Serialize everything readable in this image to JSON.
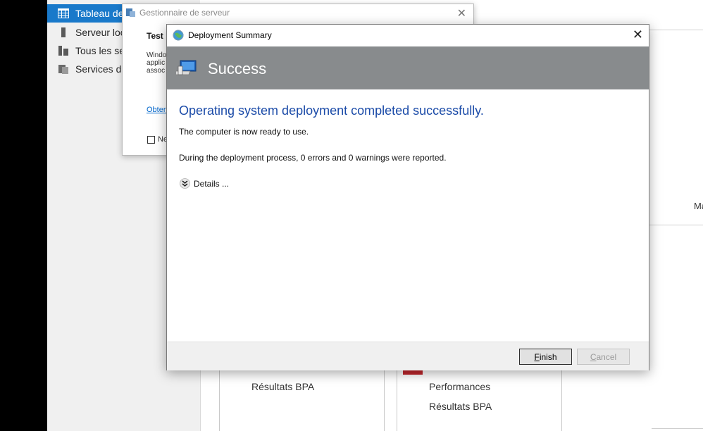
{
  "server_manager": {
    "sidebar": {
      "items": [
        {
          "label": "Tableau de",
          "icon": "dashboard-grid-icon",
          "active": true
        },
        {
          "label": "Serveur loc",
          "icon": "server-icon",
          "active": false
        },
        {
          "label": "Tous les se",
          "icon": "servers-icon",
          "active": false
        },
        {
          "label": "Services de",
          "icon": "file-services-icon",
          "active": false
        }
      ]
    },
    "panel_text": "Ma",
    "tiles": [
      {
        "rows": [
          "Résultats BPA"
        ]
      },
      {
        "rows": [
          "Performances",
          "Résultats BPA"
        ]
      }
    ]
  },
  "background_dialog": {
    "title": "Gestionnaire de serveur",
    "heading": "Test",
    "body_lines": [
      "Windo",
      "applic",
      "assoc"
    ],
    "link": "Obten",
    "checkbox_label": "Ne"
  },
  "dialog": {
    "title": "Deployment Summary",
    "close_glyph": "✕",
    "banner_title": "Success",
    "headline": "Operating system deployment completed successfully.",
    "line1": "The computer is now ready to use.",
    "line2": "During the deployment process, 0 errors and 0 warnings were reported.",
    "details_label": "Details ...",
    "finish_mnemonic": "F",
    "finish_rest": "inish",
    "cancel_mnemonic": "C",
    "cancel_rest": "ancel"
  },
  "colors": {
    "sidebar_active": "#1979ca",
    "banner": "#888b8d",
    "headline": "#1b4ba8",
    "bpa_red": "#c1272d"
  }
}
